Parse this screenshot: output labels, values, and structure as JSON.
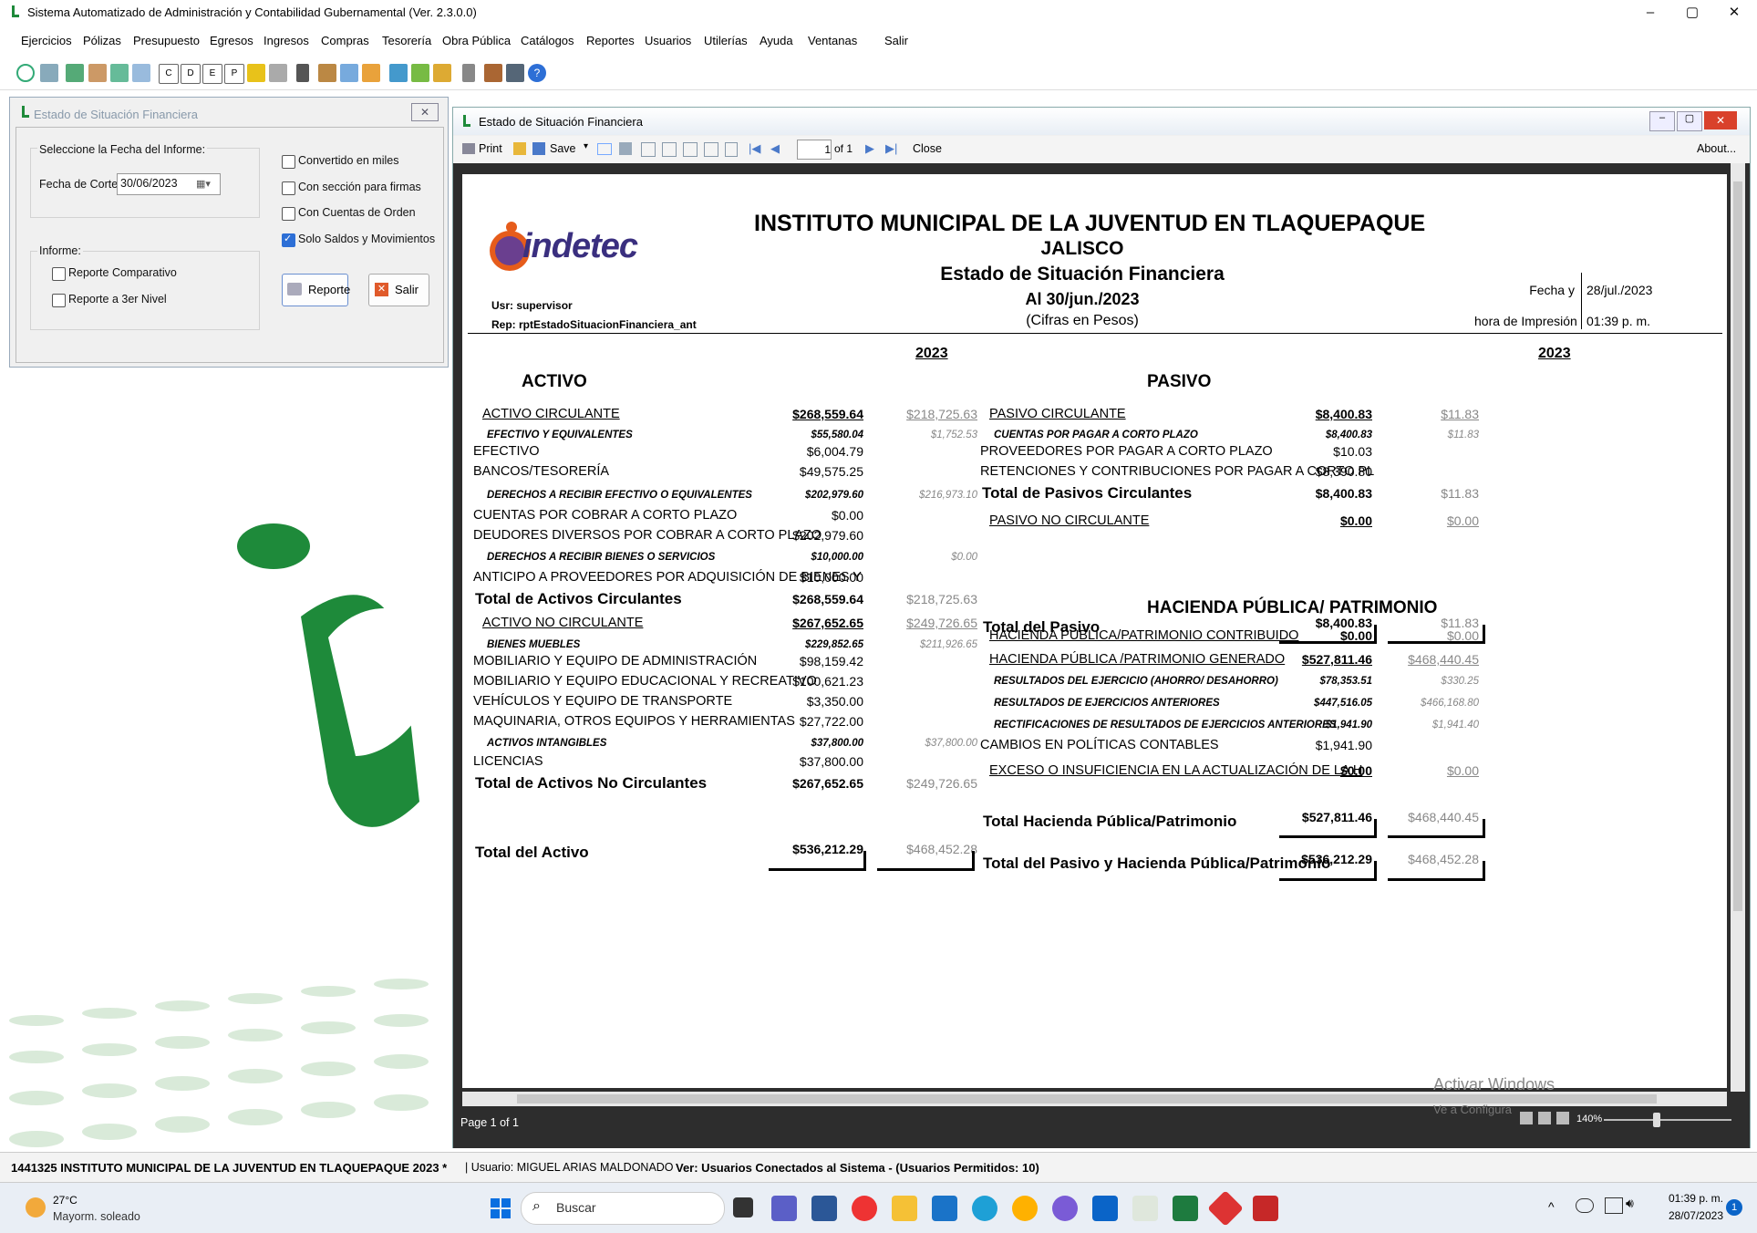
{
  "window": {
    "title": "Sistema Automatizado de Administración y Contabilidad Gubernamental  (Ver. 2.3.0.0)",
    "minimize": "–",
    "maximize": "▢",
    "close": "✕"
  },
  "menu": [
    "Ejercicios",
    "Pólizas",
    "Presupuesto",
    "Egresos",
    "Ingresos",
    "Compras",
    "Tesorería",
    "Obra Pública",
    "Catálogos",
    "Reportes",
    "Usuarios",
    "Utilerías",
    "Ayuda",
    "Ventanas",
    "Salir"
  ],
  "dialog": {
    "title": "Estado de Situación Financiera",
    "close": "✕",
    "group1_label": "Seleccione la Fecha del Informe:",
    "fecha_label": "Fecha de Corte:",
    "fecha_value": "30/06/2023",
    "informe_label": "Informe:",
    "opt_comparativo": "Reporte Comparativo",
    "opt_tercer": "Reporte a 3er Nivel",
    "chk_miles": "Convertido en miles",
    "chk_firmas": "Con sección para firmas",
    "chk_orden": "Con Cuentas de Orden",
    "chk_saldos": "Solo Saldos y Movimientos",
    "btn_reporte": "Reporte",
    "btn_salir": "Salir"
  },
  "report_window": {
    "title": "Estado de Situación Financiera",
    "print": "Print",
    "save": "Save",
    "page_input": "1",
    "page_of": "of 1",
    "close": "Close",
    "about": "About...",
    "page_label": "Page 1 of 1",
    "zoom": "140%",
    "watermark1": "Activar Windows",
    "watermark2": "Ve a Configura"
  },
  "report": {
    "logo_text": "indetec",
    "title": "INSTITUTO MUNICIPAL DE LA JUVENTUD EN TLAQUEPAQUE",
    "state": "JALISCO",
    "subtitle": "Estado de Situación Financiera",
    "date": "Al 30/jun./2023",
    "cifras": "(Cifras en Pesos)",
    "usr": "Usr: supervisor",
    "rep": "Rep: rptEstadoSituacionFinanciera_ant",
    "fecha_label": "Fecha y",
    "fecha_value": "28/jul./2023",
    "hora_label": "hora de Impresión",
    "hora_value": "01:39 p. m.",
    "year_left": "2023",
    "year_right": "2023",
    "activo": "ACTIVO",
    "pasivo": "PASIVO",
    "hacienda": "HACIENDA PÚBLICA/ PATRIMONIO",
    "left_rows": [
      {
        "label": "ACTIVO CIRCULANTE",
        "v1": "$268,559.64",
        "v2": "$218,725.63",
        "style": "sec"
      },
      {
        "label": "EFECTIVO Y EQUIVALENTES",
        "v1": "$55,580.04",
        "v2": "$1,752.53",
        "style": "sub"
      },
      {
        "label": "EFECTIVO",
        "v1": "$6,004.79",
        "v2": "",
        "style": "det"
      },
      {
        "label": "BANCOS/TESORERÍA",
        "v1": "$49,575.25",
        "v2": "",
        "style": "det"
      },
      {
        "label": "DERECHOS A RECIBIR EFECTIVO O EQUIVALENTES",
        "v1": "$202,979.60",
        "v2": "$216,973.10",
        "style": "sub"
      },
      {
        "label": "CUENTAS POR COBRAR A CORTO PLAZO",
        "v1": "$0.00",
        "v2": "",
        "style": "det"
      },
      {
        "label": "DEUDORES DIVERSOS POR COBRAR A CORTO PLAZO",
        "v1": "$202,979.60",
        "v2": "",
        "style": "det"
      },
      {
        "label": "DERECHOS A RECIBIR BIENES O SERVICIOS",
        "v1": "$10,000.00",
        "v2": "$0.00",
        "style": "sub"
      },
      {
        "label": "ANTICIPO A PROVEEDORES POR ADQUISICIÓN DE BIENES Y",
        "v1": "$10,000.00",
        "v2": "",
        "style": "det"
      },
      {
        "label": "Total de Activos Circulantes",
        "v1": "$268,559.64",
        "v2": "$218,725.63",
        "style": "tot"
      },
      {
        "label": "ACTIVO NO CIRCULANTE",
        "v1": "$267,652.65",
        "v2": "$249,726.65",
        "style": "sec"
      },
      {
        "label": "BIENES MUEBLES",
        "v1": "$229,852.65",
        "v2": "$211,926.65",
        "style": "sub"
      },
      {
        "label": "MOBILIARIO Y EQUIPO DE ADMINISTRACIÓN",
        "v1": "$98,159.42",
        "v2": "",
        "style": "det"
      },
      {
        "label": "MOBILIARIO Y EQUIPO EDUCACIONAL Y RECREATIVO",
        "v1": "$100,621.23",
        "v2": "",
        "style": "det"
      },
      {
        "label": "VEHÍCULOS Y EQUIPO DE TRANSPORTE",
        "v1": "$3,350.00",
        "v2": "",
        "style": "det"
      },
      {
        "label": "MAQUINARIA, OTROS EQUIPOS Y HERRAMIENTAS",
        "v1": "$27,722.00",
        "v2": "",
        "style": "det"
      },
      {
        "label": "ACTIVOS INTANGIBLES",
        "v1": "$37,800.00",
        "v2": "$37,800.00",
        "style": "sub"
      },
      {
        "label": "LICENCIAS",
        "v1": "$37,800.00",
        "v2": "",
        "style": "det"
      },
      {
        "label": "Total de Activos No Circulantes",
        "v1": "$267,652.65",
        "v2": "$249,726.65",
        "style": "tot"
      }
    ],
    "total_activo": {
      "label": "Total del Activo",
      "v1": "$536,212.29",
      "v2": "$468,452.28"
    },
    "right_rows": [
      {
        "label": "PASIVO CIRCULANTE",
        "v1": "$8,400.83",
        "v2": "$11.83",
        "style": "sec"
      },
      {
        "label": "CUENTAS POR PAGAR A CORTO PLAZO",
        "v1": "$8,400.83",
        "v2": "$11.83",
        "style": "sub"
      },
      {
        "label": "PROVEEDORES POR PAGAR A CORTO PLAZO",
        "v1": "$10.03",
        "v2": "",
        "style": "det"
      },
      {
        "label": "RETENCIONES Y CONTRIBUCIONES POR PAGAR A CORTO PL",
        "v1": "$8,390.80",
        "v2": "",
        "style": "det"
      },
      {
        "label": "Total de Pasivos Circulantes",
        "v1": "$8,400.83",
        "v2": "$11.83",
        "style": "tot"
      },
      {
        "label": "PASIVO NO CIRCULANTE",
        "v1": "$0.00",
        "v2": "$0.00",
        "style": "sec"
      }
    ],
    "total_pasivo": {
      "label": "Total del Pasivo",
      "v1": "$8,400.83",
      "v2": "$11.83"
    },
    "hacienda_rows": [
      {
        "label": "HACIENDA PÚBLICA/PATRIMONIO CONTRIBUIDO",
        "v1": "$0.00",
        "v2": "$0.00",
        "style": "sec"
      },
      {
        "label": "HACIENDA PÚBLICA /PATRIMONIO GENERADO",
        "v1": "$527,811.46",
        "v2": "$468,440.45",
        "style": "sec"
      },
      {
        "label": "RESULTADOS DEL EJERCICIO (AHORRO/ DESAHORRO)",
        "v1": "$78,353.51",
        "v2": "$330.25",
        "style": "sub"
      },
      {
        "label": "RESULTADOS DE EJERCICIOS ANTERIORES",
        "v1": "$447,516.05",
        "v2": "$466,168.80",
        "style": "sub"
      },
      {
        "label": "RECTIFICACIONES DE RESULTADOS DE EJERCICIOS ANTERIORES",
        "v1": "$1,941.90",
        "v2": "$1,941.40",
        "style": "sub"
      },
      {
        "label": "CAMBIOS EN POLÍTICAS CONTABLES",
        "v1": "$1,941.90",
        "v2": "",
        "style": "det"
      },
      {
        "label": "EXCESO O INSUFICIENCIA EN LA ACTUALIZACIÓN DE LA H",
        "v1": "$0.00",
        "v2": "$0.00",
        "style": "sec"
      }
    ],
    "total_hacienda": {
      "label": "Total Hacienda Pública/Patrimonio",
      "v1": "$527,811.46",
      "v2": "$468,440.45"
    },
    "total_pasivo_hacienda": {
      "label": "Total del Pasivo y Hacienda Pública/Patrimonio",
      "v1": "$536,212.29",
      "v2": "$468,452.28"
    }
  },
  "statusbar": {
    "entity": "1441325 INSTITUTO MUNICIPAL DE LA JUVENTUD EN TLAQUEPAQUE  2023   *",
    "user": "| Usuario: MIGUEL ARIAS MALDONADO",
    "connected": "Ver: Usuarios Conectados al Sistema - (Usuarios Permitidos: 10)"
  },
  "taskbar": {
    "temp": "27°C",
    "weather": "Mayorm. soleado",
    "search": "Buscar",
    "time": "01:39 p. m.",
    "date": "28/07/2023",
    "notif": "1"
  },
  "colors": {
    "accent": "#2d6fd6",
    "green": "#1e8a3a",
    "dark": "#2d2d2d"
  }
}
